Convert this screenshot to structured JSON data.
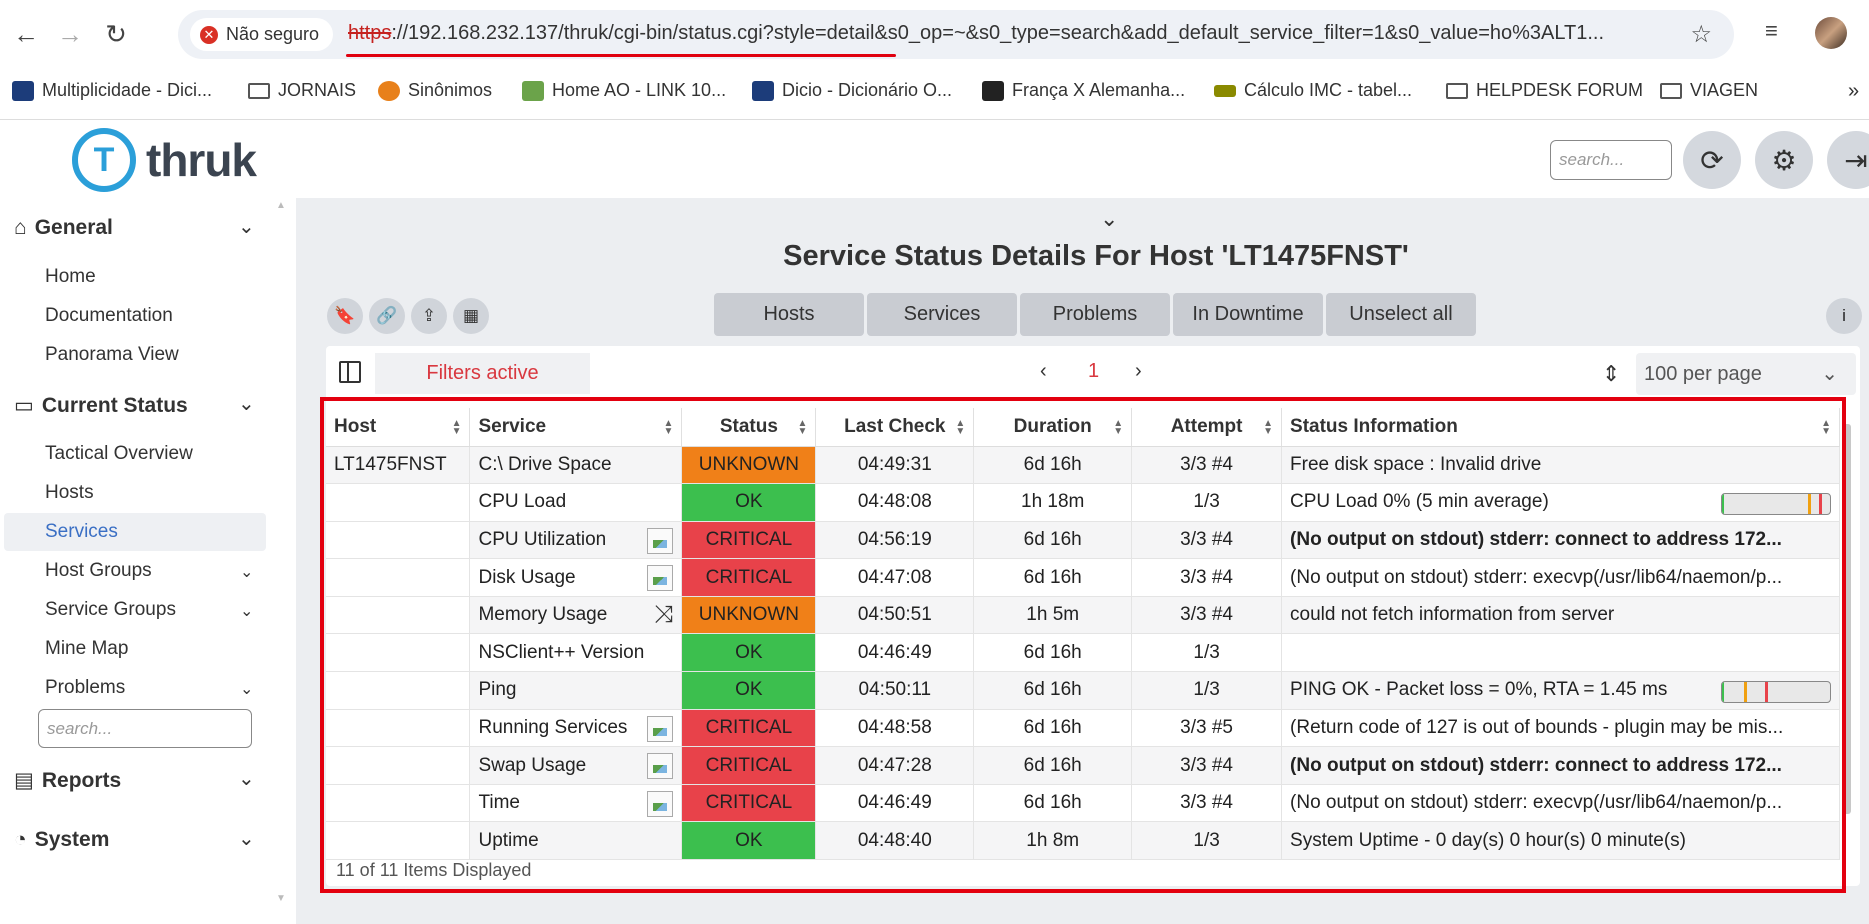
{
  "browser": {
    "insecure_label": "Não seguro",
    "url_scheme": "https",
    "url_rest": "://192.168.232.137/thruk/cgi-bin/status.cgi?style=detail&s0_op=~&s0_type=search&add_default_service_filter=1&s0_value=ho%3ALT1..."
  },
  "bookmarks": [
    {
      "label": "Multiplicidade - Dici...",
      "icon": "dicio-icon"
    },
    {
      "label": "JORNAIS",
      "icon": "folder-icon"
    },
    {
      "label": "Sinônimos",
      "icon": "sinonimos-icon"
    },
    {
      "label": "Home AO - LINK 10...",
      "icon": "home-ao-icon"
    },
    {
      "label": "Dicio - Dicionário O...",
      "icon": "dicio-icon"
    },
    {
      "label": "França X Alemanha...",
      "icon": "mf-icon"
    },
    {
      "label": "Cálculo IMC - tabel...",
      "icon": "imc-icon"
    },
    {
      "label": "HELPDESK FORUM",
      "icon": "folder-icon"
    },
    {
      "label": "VIAGEN",
      "icon": "folder-icon"
    }
  ],
  "header": {
    "logo_text": "thruk",
    "search_placeholder": "search..."
  },
  "sidebar": {
    "general": {
      "label": "General",
      "items": [
        "Home",
        "Documentation",
        "Panorama View"
      ]
    },
    "current_status": {
      "label": "Current Status",
      "items": [
        "Tactical Overview",
        "Hosts",
        "Services",
        "Host Groups",
        "Service Groups",
        "Mine Map",
        "Problems"
      ],
      "active": "Services"
    },
    "search_placeholder": "search...",
    "reports": {
      "label": "Reports"
    },
    "system": {
      "label": "System"
    }
  },
  "main": {
    "title": "Service Status Details For Host 'LT1475FNST'",
    "tabs": [
      "Hosts",
      "Services",
      "Problems",
      "In Downtime",
      "Unselect all"
    ],
    "info_label": "i",
    "filters_label": "Filters active",
    "page_number": "1",
    "per_page": "100 per page",
    "columns": [
      "Host",
      "Service",
      "Status",
      "Last Check",
      "Duration",
      "Attempt",
      "Status Information"
    ],
    "rows": [
      {
        "host": "LT1475FNST",
        "service": "C:\\ Drive Space",
        "status": "UNKNOWN",
        "last_check": "04:49:31",
        "duration": "6d 16h",
        "attempt": "3/3 #4",
        "info": "Free disk space : Invalid drive",
        "bold": false
      },
      {
        "host": "",
        "service": "CPU Load",
        "status": "OK",
        "last_check": "04:48:08",
        "duration": "1h 18m",
        "attempt": "1/3",
        "info": "CPU Load 0% (5 min average)",
        "bold": false,
        "perf": {
          "value": 0.02,
          "warn": 0.8,
          "crit": 0.9
        }
      },
      {
        "host": "",
        "service": "CPU Utilization",
        "status": "CRITICAL",
        "last_check": "04:56:19",
        "duration": "6d 16h",
        "attempt": "3/3 #4",
        "info": "(No output on stdout) stderr: connect to address 172...",
        "bold": true,
        "icon": "image-icon"
      },
      {
        "host": "",
        "service": "Disk Usage",
        "status": "CRITICAL",
        "last_check": "04:47:08",
        "duration": "6d 16h",
        "attempt": "3/3 #4",
        "info": "(No output on stdout) stderr: execvp(/usr/lib64/naemon/p...",
        "bold": false,
        "icon": "image-icon"
      },
      {
        "host": "",
        "service": "Memory Usage",
        "status": "UNKNOWN",
        "last_check": "04:50:51",
        "duration": "1h 5m",
        "attempt": "3/3 #4",
        "info": "could not fetch information from server",
        "bold": false,
        "icon": "shuffle-icon"
      },
      {
        "host": "",
        "service": "NSClient++ Version",
        "status": "OK",
        "last_check": "04:46:49",
        "duration": "6d 16h",
        "attempt": "1/3",
        "info": "",
        "bold": false
      },
      {
        "host": "",
        "service": "Ping",
        "status": "OK",
        "last_check": "04:50:11",
        "duration": "6d 16h",
        "attempt": "1/3",
        "info": "PING OK - Packet loss = 0%, RTA = 1.45 ms",
        "bold": false,
        "perf": {
          "value": 0.02,
          "warn": 0.2,
          "crit": 0.4
        }
      },
      {
        "host": "",
        "service": "Running Services",
        "status": "CRITICAL",
        "last_check": "04:48:58",
        "duration": "6d 16h",
        "attempt": "3/3 #5",
        "info": "(Return code of 127 is out of bounds - plugin may be mis...",
        "bold": false,
        "icon": "image-icon"
      },
      {
        "host": "",
        "service": "Swap Usage",
        "status": "CRITICAL",
        "last_check": "04:47:28",
        "duration": "6d 16h",
        "attempt": "3/3 #4",
        "info": "(No output on stdout) stderr: connect to address 172...",
        "bold": true,
        "icon": "image-icon"
      },
      {
        "host": "",
        "service": "Time",
        "status": "CRITICAL",
        "last_check": "04:46:49",
        "duration": "6d 16h",
        "attempt": "3/3 #4",
        "info": "(No output on stdout) stderr: execvp(/usr/lib64/naemon/p...",
        "bold": false,
        "icon": "image-icon"
      },
      {
        "host": "",
        "service": "Uptime",
        "status": "OK",
        "last_check": "04:48:40",
        "duration": "1h 8m",
        "attempt": "1/3",
        "info": "System Uptime - 0 day(s) 0 hour(s) 0 minute(s)",
        "bold": false
      }
    ],
    "items_displayed": "11 of 11 Items Displayed"
  },
  "colors": {
    "ok": "#3cbf4e",
    "critical": "#e8424a",
    "unknown": "#f08018",
    "accent": "#3a6fc4",
    "highlight_frame": "#e3000f"
  }
}
